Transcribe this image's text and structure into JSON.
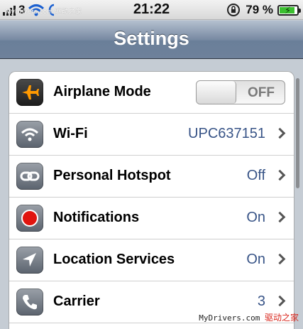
{
  "status_bar": {
    "signal_bars": 4,
    "carrier": "3",
    "watermark_top": "MyDrivers.com 驱动之家",
    "time": "21:22",
    "battery_percent": "79 %",
    "battery_level": 0.79
  },
  "nav": {
    "title": "Settings"
  },
  "rows": [
    {
      "label": "Airplane Mode",
      "toggle": "OFF"
    },
    {
      "label": "Wi-Fi",
      "value": "UPC637151"
    },
    {
      "label": "Personal Hotspot",
      "value": "Off"
    },
    {
      "label": "Notifications",
      "value": "On"
    },
    {
      "label": "Location Services",
      "value": "On"
    },
    {
      "label": "Carrier",
      "value": "3"
    }
  ],
  "watermark": {
    "text": "MyDrivers.com",
    "cn": "驱动之家"
  },
  "colors": {
    "airplane_icon": "#ff9900",
    "notifications_icon": "#e0150f",
    "value_text": "#385487"
  }
}
